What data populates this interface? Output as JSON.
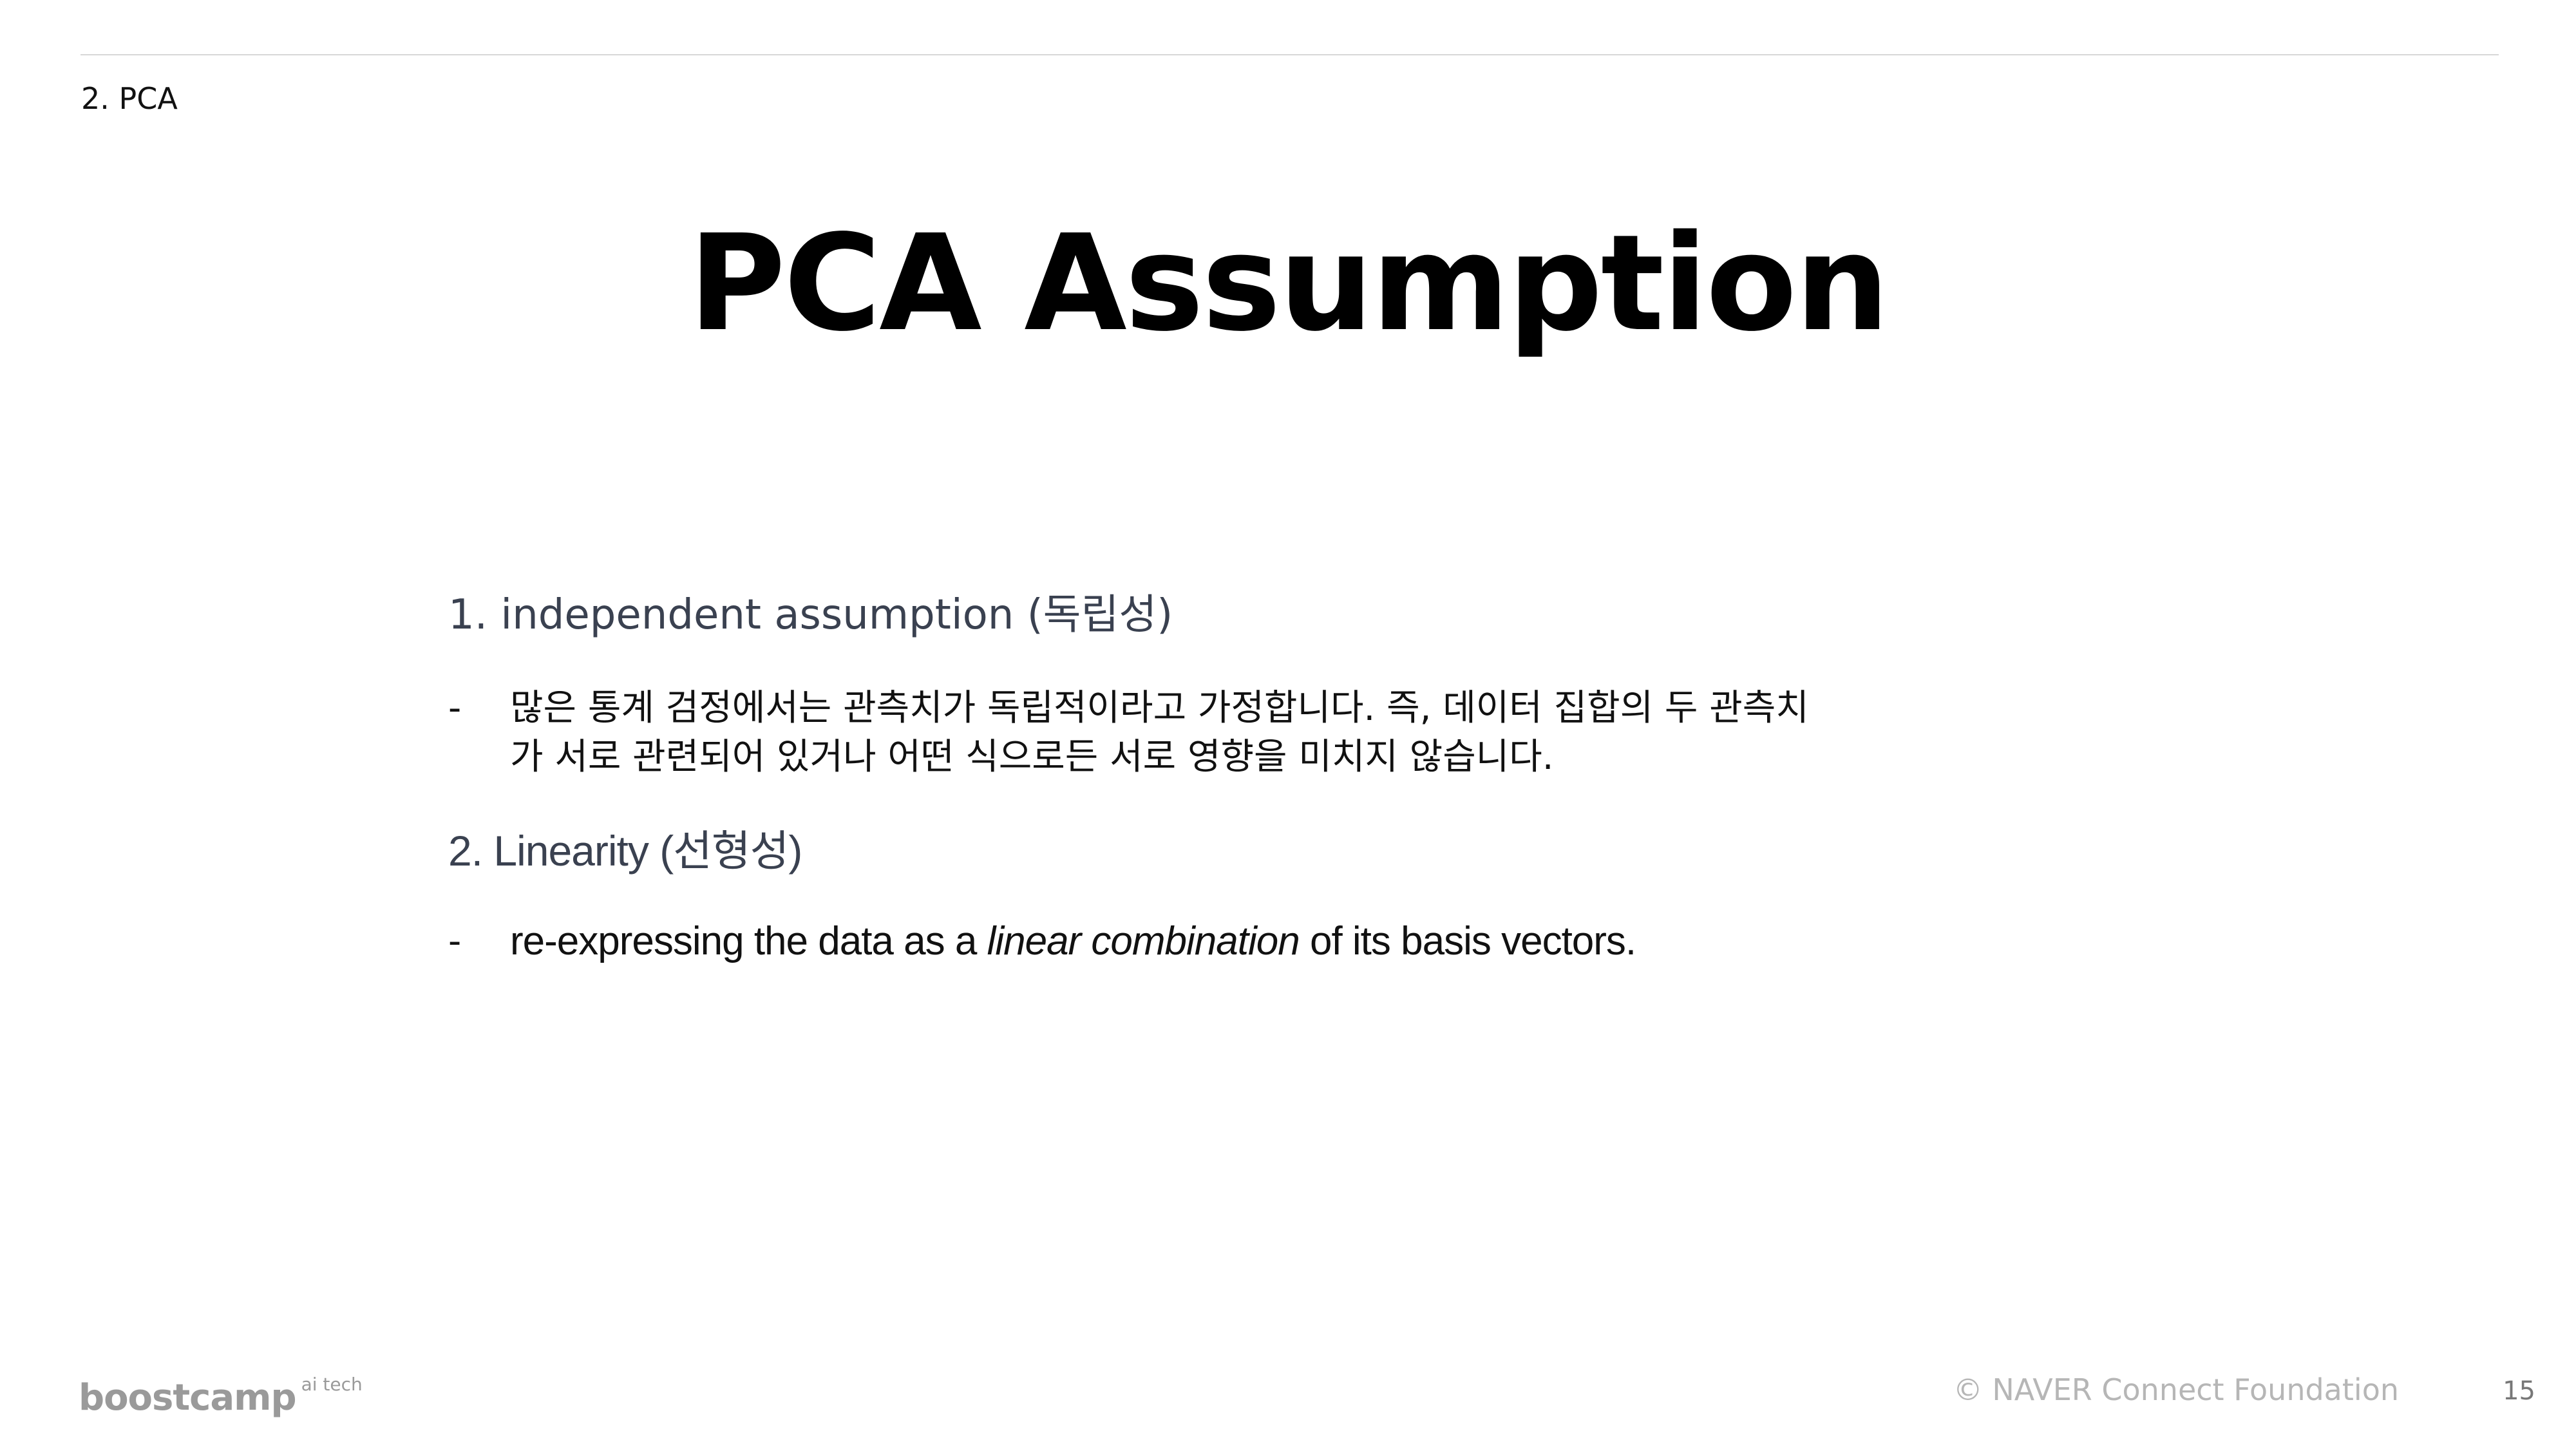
{
  "header": {
    "section": "2. PCA"
  },
  "title": "PCA Assumption",
  "items": [
    {
      "heading": "1. independent assumption (독립성)",
      "bullet": {
        "dash": "-",
        "line1": "많은 통계 검정에서는 관측치가 독립적이라고 가정합니다. 즉,  데이터 집합의 두 관측치",
        "line2": "가 서로 관련되어 있거나 어떤 식으로든 서로 영향을 미치지 않습니다."
      }
    },
    {
      "heading_num": "2.",
      "heading_text": "Linearity",
      "heading_korean": "(선형성)",
      "bullet": {
        "dash": "-",
        "text_before": "re-expressing the data as a ",
        "text_italic": "linear combination",
        "text_after": " of its basis vectors."
      }
    }
  ],
  "footer": {
    "logo": "boostcamp",
    "logo_sup": "ai tech",
    "copyright": "© NAVER Connect Foundation",
    "page_number": "15"
  }
}
